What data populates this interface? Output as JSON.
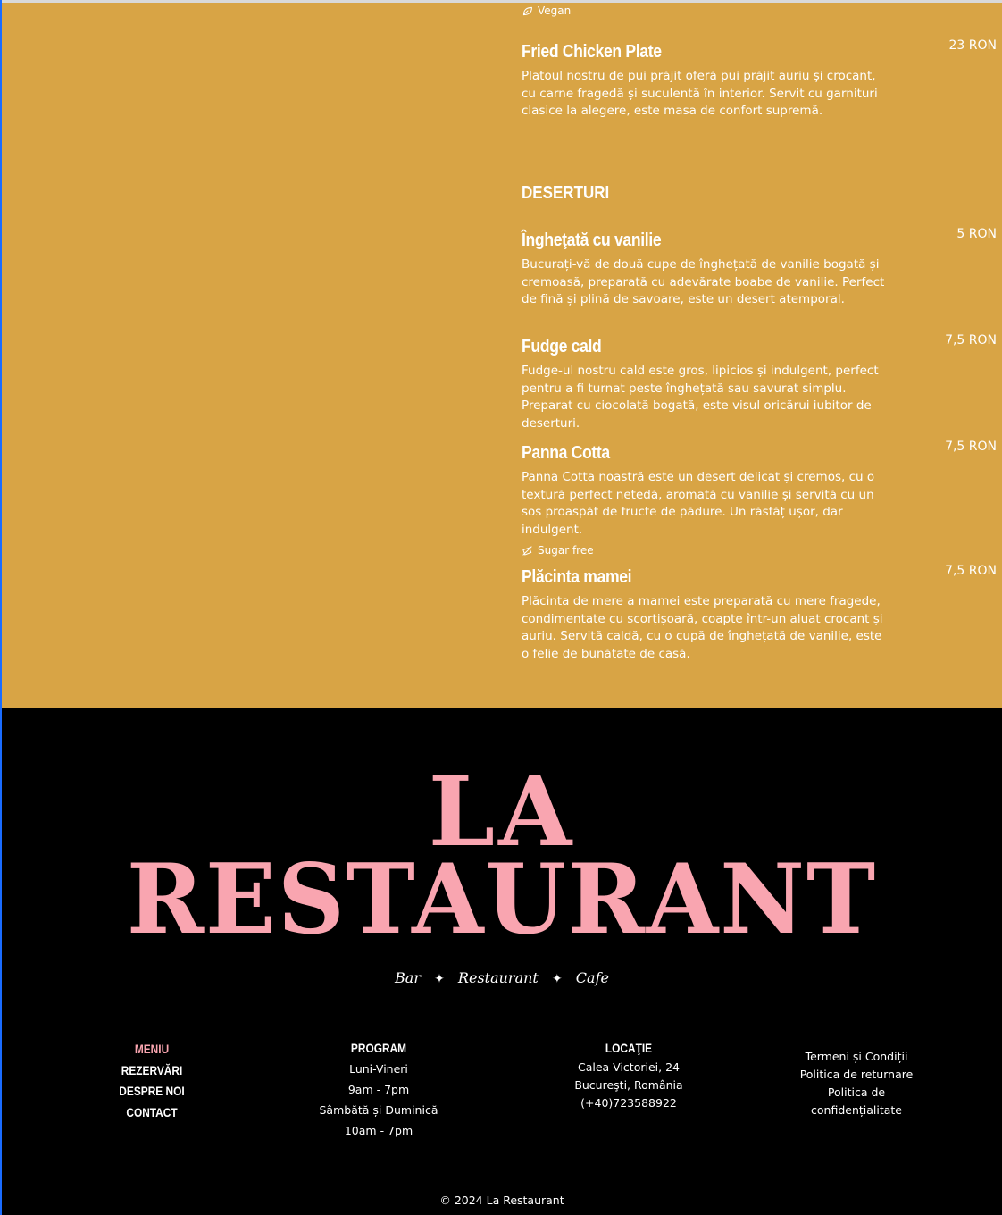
{
  "menu": {
    "vegan_tag": "Vegan",
    "fried_chicken": {
      "title": "Fried Chicken Plate",
      "price": "23 RON",
      "desc": "Platoul nostru de pui prăjit oferă pui prăjit auriu și crocant, cu carne fragedă și suculentă în interior. Servit cu garnituri clasice la alegere, este masa de confort supremă."
    },
    "section_title": "DESERTURI",
    "items": [
      {
        "title": "Îngheţată cu vanilie",
        "price": "5 RON",
        "desc": "Bucurați-vă de două cupe de înghețată de vanilie bogată și cremoasă, preparată cu adevărate boabe de vanilie. Perfect de fină și plină de savoare, este un desert atemporal."
      },
      {
        "title": "Fudge cald",
        "price": "7,5 RON",
        "desc": "Fudge-ul nostru cald este gros, lipicios și indulgent, perfect pentru a fi turnat peste înghețată sau savurat simplu. Preparat cu ciocolată bogată, este visul oricărui iubitor de deserturi."
      },
      {
        "title": "Panna Cotta",
        "price": "7,5 RON",
        "desc": "Panna Cotta noastră este un desert delicat și cremos, cu o textură perfect netedă, aromată cu vanilie și servită cu un sos proaspăt de fructe de pădure. Un răsfăț ușor, dar indulgent.",
        "tag": "Sugar free"
      },
      {
        "title": "Plăcinta mamei",
        "price": "7,5 RON",
        "desc": "Plăcinta de mere a mamei este preparată cu mere fragede, condimentate cu scorțișoară, coapte într-un aluat crocant și auriu. Servită caldă, cu o cupă de înghețată de vanilie, este o felie de bunătate de casă."
      }
    ]
  },
  "footer": {
    "logo_line1": "LA",
    "logo_line2": "RESTAURANT",
    "tagline": {
      "a": "Bar",
      "b": "Restaurant",
      "c": "Cafe"
    },
    "nav": [
      "MENIU",
      "REZERVĂRI",
      "DESPRE NOI",
      "CONTACT"
    ],
    "program": {
      "title": "PROGRAM",
      "lines": [
        "Luni-Vineri",
        "9am - 7pm",
        "Sâmbătă și Duminică",
        "10am - 7pm"
      ]
    },
    "locatie": {
      "title": "LOCAŢIE",
      "lines": [
        "Calea Victoriei, 24",
        "Bucureşti, România",
        "(+40)723588922"
      ]
    },
    "legal": [
      "Termeni și Condiții",
      "Politica de returnare",
      "Politica de",
      "confidențialitate"
    ],
    "copyright": "© 2024 La Restaurant"
  },
  "colors": {
    "menu_bg": "#d8a445",
    "footer_bg": "#000000",
    "accent_pink": "#f9a5b0"
  }
}
